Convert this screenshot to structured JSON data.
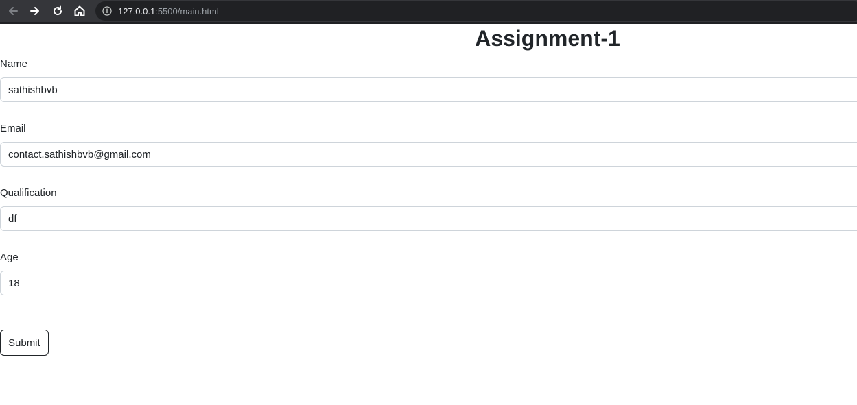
{
  "browser": {
    "url_host": "127.0.0.1",
    "url_rest": ":5500/main.html",
    "icons": {
      "back": "back-arrow-icon",
      "forward": "forward-arrow-icon",
      "reload": "reload-icon",
      "home": "home-icon",
      "info": "info-icon"
    }
  },
  "page": {
    "title": "Assignment-1",
    "fields": [
      {
        "label": "Name",
        "value": "sathishbvb"
      },
      {
        "label": "Email",
        "value": "contact.sathishbvb@gmail.com"
      },
      {
        "label": "Qualification",
        "value": "df"
      },
      {
        "label": "Age",
        "value": "18"
      }
    ],
    "submit_label": "Submit"
  },
  "colors": {
    "toolbar": "#35363a",
    "omnibox": "#202124",
    "text": "#212529",
    "input_border": "#ced4da"
  }
}
